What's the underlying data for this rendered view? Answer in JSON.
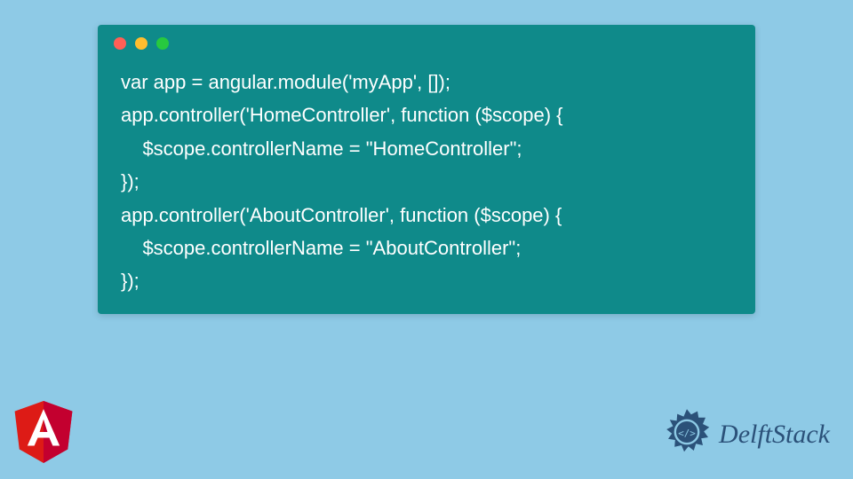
{
  "code": {
    "lines": [
      "var app = angular.module('myApp', []);",
      "app.controller('HomeController', function ($scope) {",
      "    $scope.controllerName = \"HomeController\";",
      "});",
      "app.controller('AboutController', function ($scope) {",
      "    $scope.controllerName = \"AboutController\";",
      "});"
    ]
  },
  "brand": {
    "name": "DelftStack"
  },
  "colors": {
    "background": "#8ecae6",
    "code_block_bg": "#0f8a8a",
    "code_text": "#ffffff",
    "angular_shield": "#dd1b16",
    "angular_letter": "#ffffff",
    "brand_text": "#2b5179",
    "brand_icon": "#2b5179"
  }
}
